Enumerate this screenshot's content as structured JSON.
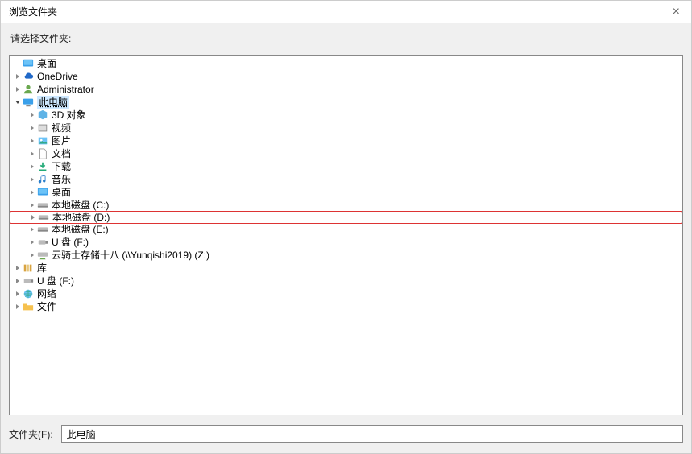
{
  "title": "浏览文件夹",
  "close_glyph": "×",
  "prompt": "请选择文件夹:",
  "tree": {
    "desktop": "桌面",
    "onedrive": "OneDrive",
    "admin": "Administrator",
    "thispc": "此电脑",
    "pc": {
      "obj3d": "3D 对象",
      "videos": "视频",
      "pictures": "图片",
      "documents": "文档",
      "downloads": "下载",
      "music": "音乐",
      "desktop": "桌面",
      "diskc": "本地磁盘 (C:)",
      "diskd": "本地磁盘 (D:)",
      "diske": "本地磁盘 (E:)",
      "usbf": "U 盘 (F:)",
      "netz": "云骑士存储十八 (\\\\Yunqishi2019) (Z:)"
    },
    "libraries": "库",
    "usbf2": "U 盘 (F:)",
    "network": "网络",
    "files": "文件"
  },
  "folder_label": "文件夹(F):",
  "folder_value": "此电脑"
}
